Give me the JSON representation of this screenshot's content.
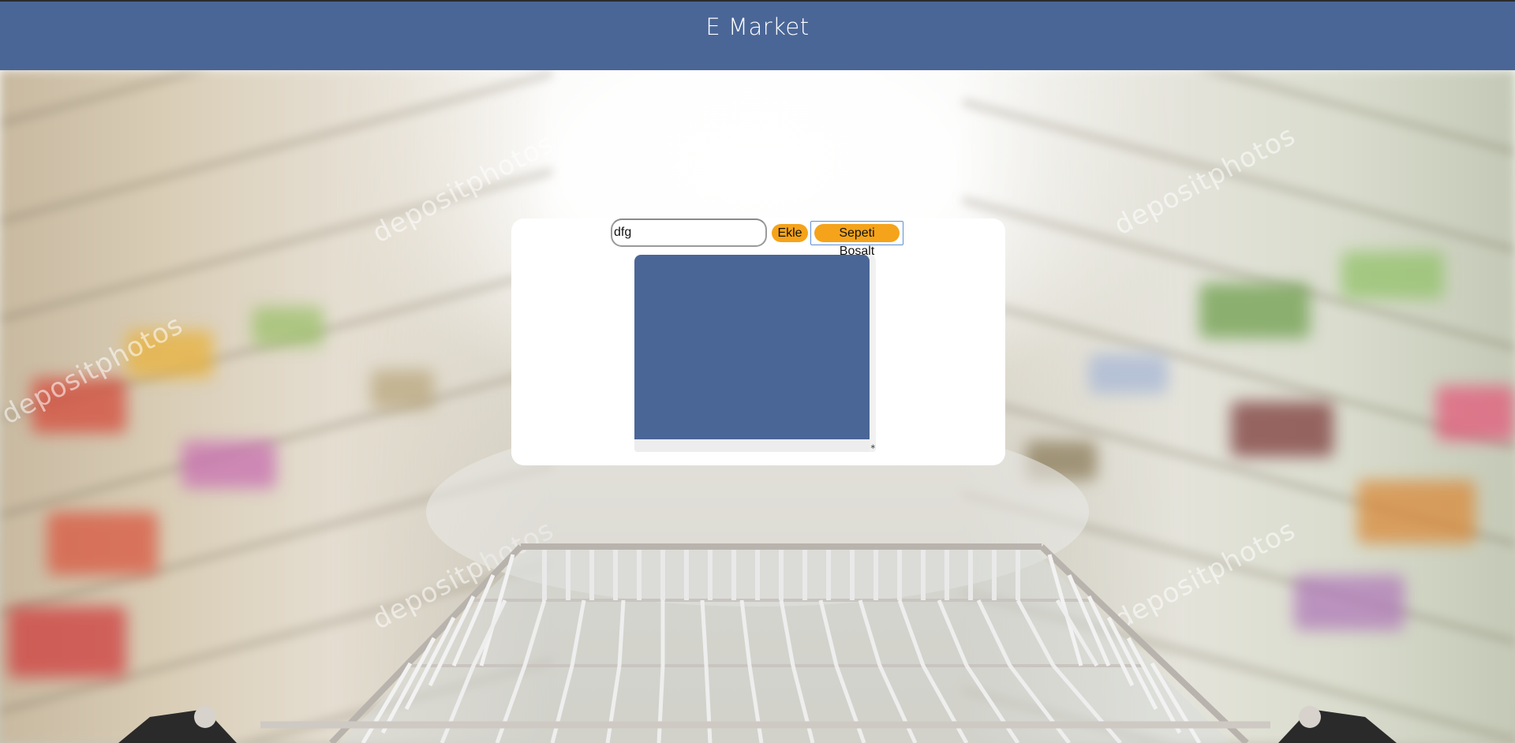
{
  "header": {
    "title": "E Market"
  },
  "form": {
    "item_input_value": "dfg",
    "add_label": "Ekle",
    "clear_label": "Sepeti Bosalt"
  },
  "background": {
    "watermark_text": "depositphotos"
  },
  "colors": {
    "header": "#4a6697",
    "button": "#f5a31a",
    "list_area": "#4a6697",
    "card": "#ffffff"
  }
}
